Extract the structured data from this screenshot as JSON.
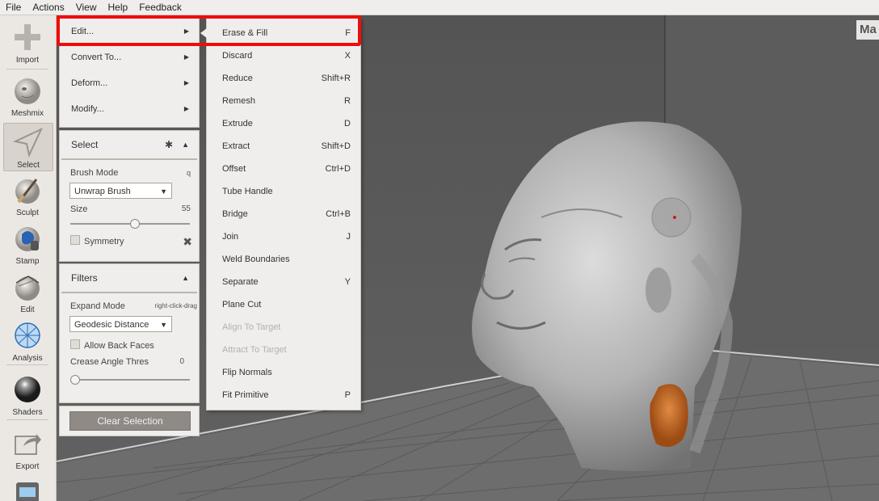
{
  "menubar": [
    "File",
    "Actions",
    "View",
    "Help",
    "Feedback"
  ],
  "toolbar": [
    {
      "label": "Import",
      "icon": "plus-icon"
    },
    {
      "label": "Meshmix",
      "icon": "meshmix-bunny-icon"
    },
    {
      "label": "Select",
      "icon": "select-arrow-icon",
      "active": true
    },
    {
      "label": "Sculpt",
      "icon": "sculpt-brush-icon"
    },
    {
      "label": "Stamp",
      "icon": "stamp-icon"
    },
    {
      "label": "Edit",
      "icon": "edit-sphere-icon"
    },
    {
      "label": "Analysis",
      "icon": "analysis-icon"
    },
    {
      "label": "Shaders",
      "icon": "shaders-ball-icon"
    },
    {
      "label": "Export",
      "icon": "export-icon"
    }
  ],
  "edit_menu": [
    {
      "label": "Edit..."
    },
    {
      "label": "Convert To..."
    },
    {
      "label": "Deform..."
    },
    {
      "label": "Modify..."
    }
  ],
  "select_panel": {
    "title": "Select",
    "brush_mode_label": "Brush Mode",
    "brush_mode_hint": "q",
    "brush_mode_value": "Unwrap Brush",
    "size_label": "Size",
    "size_value": "55",
    "symmetry_label": "Symmetry"
  },
  "filters_panel": {
    "title": "Filters",
    "expand_mode_label": "Expand Mode",
    "expand_mode_hint": "right-click-drag",
    "expand_mode_value": "Geodesic Distance",
    "allow_back_faces_label": "Allow Back Faces",
    "crease_label": "Crease Angle Thres",
    "crease_value": "0"
  },
  "clear_selection_label": "Clear Selection",
  "submenu": [
    {
      "label": "Erase & Fill",
      "shortcut": "F"
    },
    {
      "label": "Discard",
      "shortcut": "X"
    },
    {
      "label": "Reduce",
      "shortcut": "Shift+R"
    },
    {
      "label": "Remesh",
      "shortcut": "R"
    },
    {
      "label": "Extrude",
      "shortcut": "D"
    },
    {
      "label": "Extract",
      "shortcut": "Shift+D"
    },
    {
      "label": "Offset",
      "shortcut": "Ctrl+D"
    },
    {
      "label": "Tube Handle",
      "shortcut": ""
    },
    {
      "label": "Bridge",
      "shortcut": "Ctrl+B"
    },
    {
      "label": "Join",
      "shortcut": "J"
    },
    {
      "label": "Weld Boundaries",
      "shortcut": ""
    },
    {
      "label": "Separate",
      "shortcut": "Y"
    },
    {
      "label": "Plane Cut",
      "shortcut": ""
    },
    {
      "label": "Align To Target",
      "shortcut": "",
      "disabled": true
    },
    {
      "label": "Attract To Target",
      "shortcut": "",
      "disabled": true
    },
    {
      "label": "Flip Normals",
      "shortcut": ""
    },
    {
      "label": "Fit Primitive",
      "shortcut": "P"
    }
  ],
  "viewport_logo": "Ma",
  "colors": {
    "highlight": "#f00c0c",
    "selection": "#c8621e",
    "brush_circle": "#a6a6a6"
  }
}
